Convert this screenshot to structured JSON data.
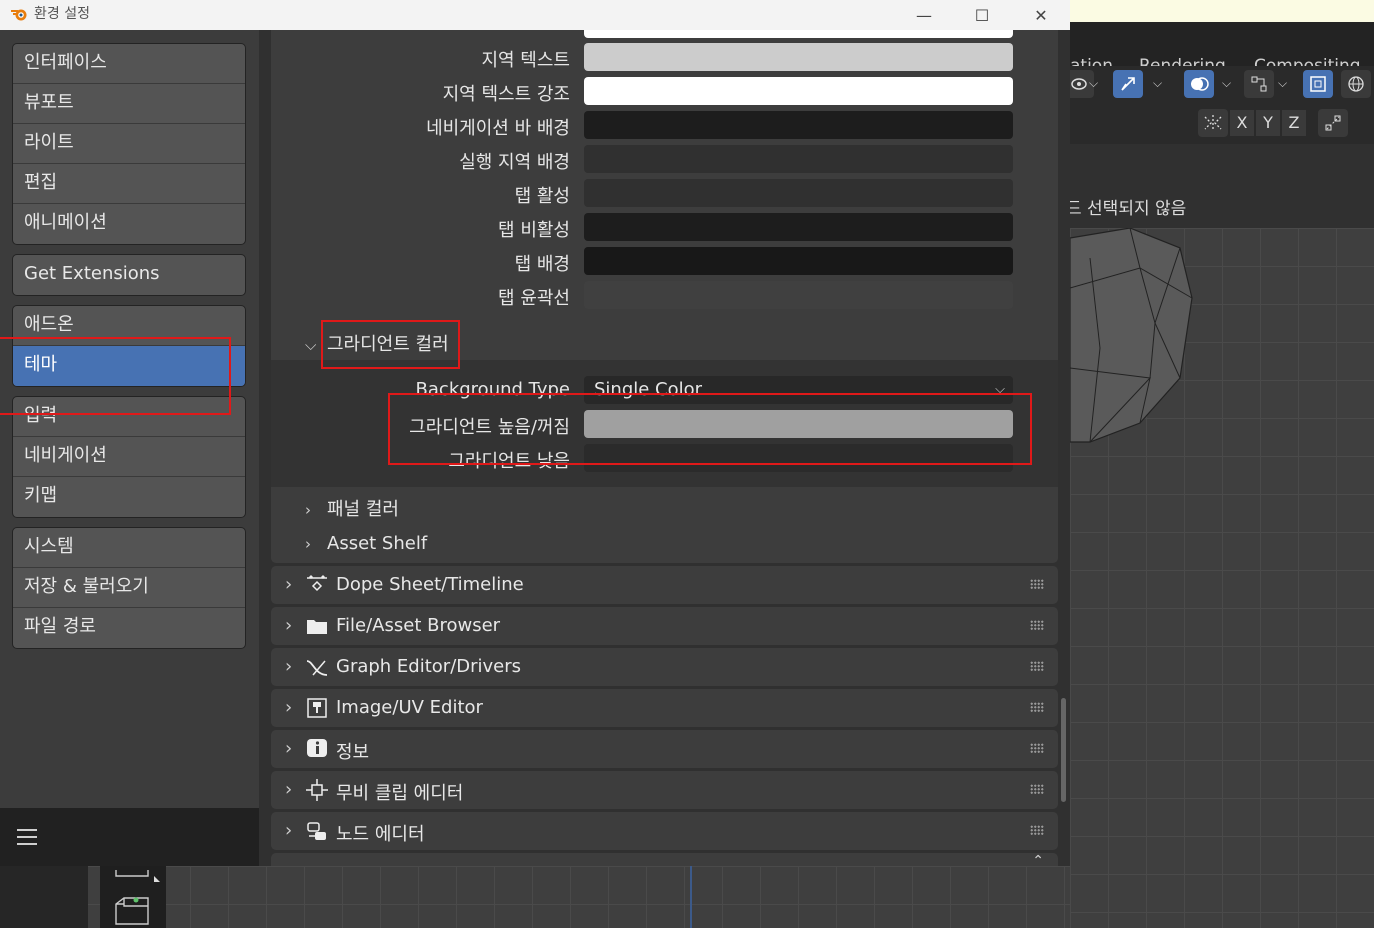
{
  "window": {
    "title": "환경 설정",
    "minimize": "—",
    "maximize": "☐",
    "close": "✕"
  },
  "sidebar": {
    "groups": [
      [
        "인터페이스",
        "뷰포트",
        "라이트",
        "편집",
        "애니메이션"
      ],
      [
        "Get Extensions"
      ],
      [
        "애드온",
        "테마"
      ],
      [
        "입력",
        "네비게이션",
        "키맵"
      ],
      [
        "시스템",
        "저장 & 불러오기",
        "파일 경로"
      ]
    ],
    "active": "테마"
  },
  "theme_rows": [
    {
      "label": "지역 텍스트",
      "color": "#cccccc"
    },
    {
      "label": "지역 텍스트 강조",
      "color": "#ffffff"
    },
    {
      "label": "네비게이션 바 배경",
      "color": "#1d1d1d"
    },
    {
      "label": "실행 지역 배경",
      "color": "#303030"
    },
    {
      "label": "탭 활성",
      "color": "#303030"
    },
    {
      "label": "탭 비활성",
      "color": "#1d1d1d"
    },
    {
      "label": "탭 배경",
      "color": "#181818"
    },
    {
      "label": "탭 윤곽선",
      "color": "#3d3d3d"
    }
  ],
  "gradient_section": {
    "title": "그라디언트 컬러",
    "background_type_label": "Background Type",
    "background_type_value": "Single Color",
    "high_off_label": "그라디언트 높음/꺼짐",
    "high_off_color": "#a0a0a0",
    "low_label": "그라디언트 낮음",
    "low_color": "#2b2b2b"
  },
  "collapsed_sections": [
    "패널 컬러",
    "Asset Shelf"
  ],
  "editor_panels": [
    {
      "label": "Dope Sheet/Timeline",
      "icon": "dopesheet-icon"
    },
    {
      "label": "File/Asset Browser",
      "icon": "folder-icon"
    },
    {
      "label": "Graph Editor/Drivers",
      "icon": "graph-editor-icon"
    },
    {
      "label": "Image/UV Editor",
      "icon": "image-editor-icon"
    },
    {
      "label": "정보",
      "icon": "info-icon"
    },
    {
      "label": "무비 클립 에디터",
      "icon": "movie-clip-icon"
    },
    {
      "label": "노드 에디터",
      "icon": "node-editor-icon"
    }
  ],
  "background_app": {
    "workspace_tabs": [
      "ation",
      "Rendering",
      "Compositing"
    ],
    "axis_buttons": [
      "X",
      "Y",
      "Z"
    ],
    "viewport_status": "드 선택되지 않음"
  },
  "colors": {
    "accent": "#4772b3",
    "annotation_red": "#e01919"
  }
}
